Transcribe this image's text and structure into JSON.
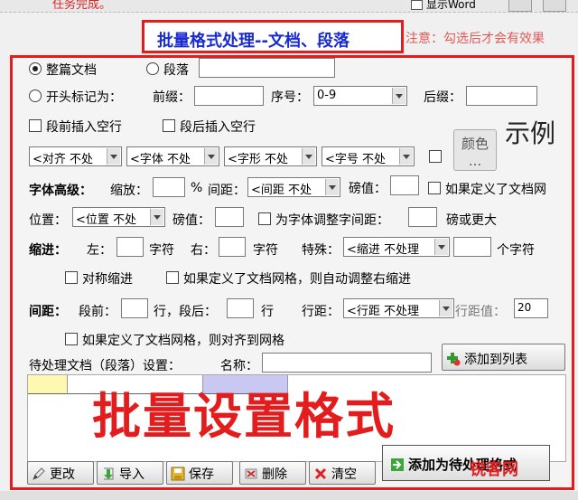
{
  "top": {
    "status_text": "任务完成。",
    "show_word_label": "显示Word"
  },
  "title": "批量格式处理--文档、段落",
  "note": "注意：勾选后才会有效果",
  "scope": {
    "whole_doc_label": "整篇文档",
    "paragraph_label": "段落",
    "paragraph_value": "",
    "begin_mark_label": "开头标记为：",
    "prefix_label": "前缀：",
    "prefix_value": "",
    "seq_label": "序号：",
    "seq_value": "0-9",
    "suffix_label": "后缀：",
    "suffix_value": ""
  },
  "blank_lines": {
    "before_label": "段前插入空行",
    "after_label": "段后插入空行"
  },
  "format_combos": {
    "align": "<对齐 不处",
    "font": "<字体 不处",
    "shape": "<字形 不处",
    "size": "<字号 不处"
  },
  "color_button": {
    "line1": "颜色",
    "line2": "..."
  },
  "sample_label": "示例",
  "font_adv": {
    "heading": "字体高级：",
    "scale_label": "缩放：",
    "scale_value": "",
    "percent_label": "%",
    "spacing_label": "间距：",
    "spacing_combo": "<间距 不处",
    "pound_label": "磅值：",
    "pound_value": "",
    "grid_label": "如果定义了文档网",
    "position_label": "位置：",
    "position_combo": "<位置 不处",
    "pound2_label": "磅值：",
    "pound2_value": "",
    "kerning_label": "为字体调整字间距：",
    "kerning_value": "",
    "kerning_suffix": "磅或更大"
  },
  "indent": {
    "heading": "缩进：",
    "left_label": "左：",
    "left_value": "",
    "left_unit": "字符",
    "right_label": "右：",
    "right_value": "",
    "right_unit": "字符",
    "special_label": "特殊：",
    "special_combo": "<缩进 不处理",
    "special_value": "",
    "special_unit": "个字符",
    "mirror_label": "对称缩进",
    "auto_right_label": "如果定义了文档网格，则自动调整右缩进"
  },
  "spacing": {
    "heading": "间距：",
    "before_label": "段前：",
    "before_value": "",
    "before_unit": "行，段后：",
    "after_value": "",
    "after_unit": "行",
    "line_label": "行距：",
    "line_combo": "<行距 不处理",
    "line_value_label": "行距值：",
    "line_value": "20",
    "align_grid_label": "如果定义了文档网格，则对齐到网格"
  },
  "pending": {
    "label": "待处理文档（段落）设置：",
    "name_label": "名称：",
    "name_value": "",
    "add_to_list": "添加到列表"
  },
  "watermark_text": "批量设置格式",
  "bottom_buttons": {
    "edit": "更改",
    "import": "导入",
    "save": "保存",
    "delete": "删除",
    "clear": "清空",
    "add_pending": "添加为待处理格式"
  },
  "site_badge": "锐客网"
}
